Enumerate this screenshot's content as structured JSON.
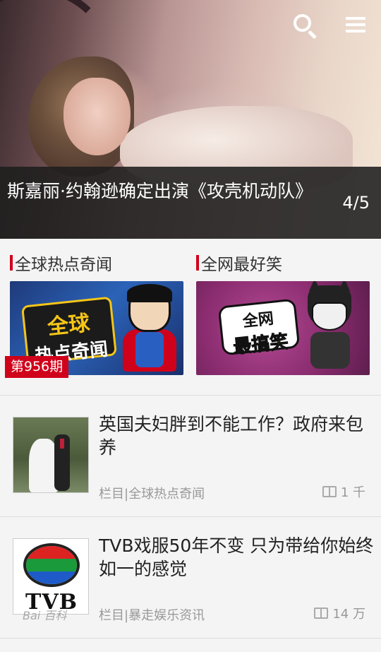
{
  "hero": {
    "title": "斯嘉丽·约翰逊确定出演《攻壳机动队》",
    "counter": "4/5"
  },
  "categories": [
    {
      "label": "全球热点奇闻",
      "thumb_title_1": "全球",
      "thumb_title_2": "热点奇闻",
      "issue_badge": "第956期"
    },
    {
      "label": "全网最好笑",
      "thumb_title_1": "全网",
      "thumb_title_2": "最搞笑"
    }
  ],
  "news": [
    {
      "title": "英国夫妇胖到不能工作？政府来包养",
      "meta": "栏目|全球热点奇闻",
      "count": "1 千"
    },
    {
      "title": "TVB戏服50年不变 只为带给你始终如一的感觉",
      "meta": "栏目|暴走娱乐资讯",
      "count": "14 万",
      "thumb_text": "TVB"
    }
  ],
  "watermark": "Bai 百科",
  "colors": {
    "accent": "#d0021b",
    "meta_text": "#999999",
    "caption_bg": "#1e1e1e"
  }
}
